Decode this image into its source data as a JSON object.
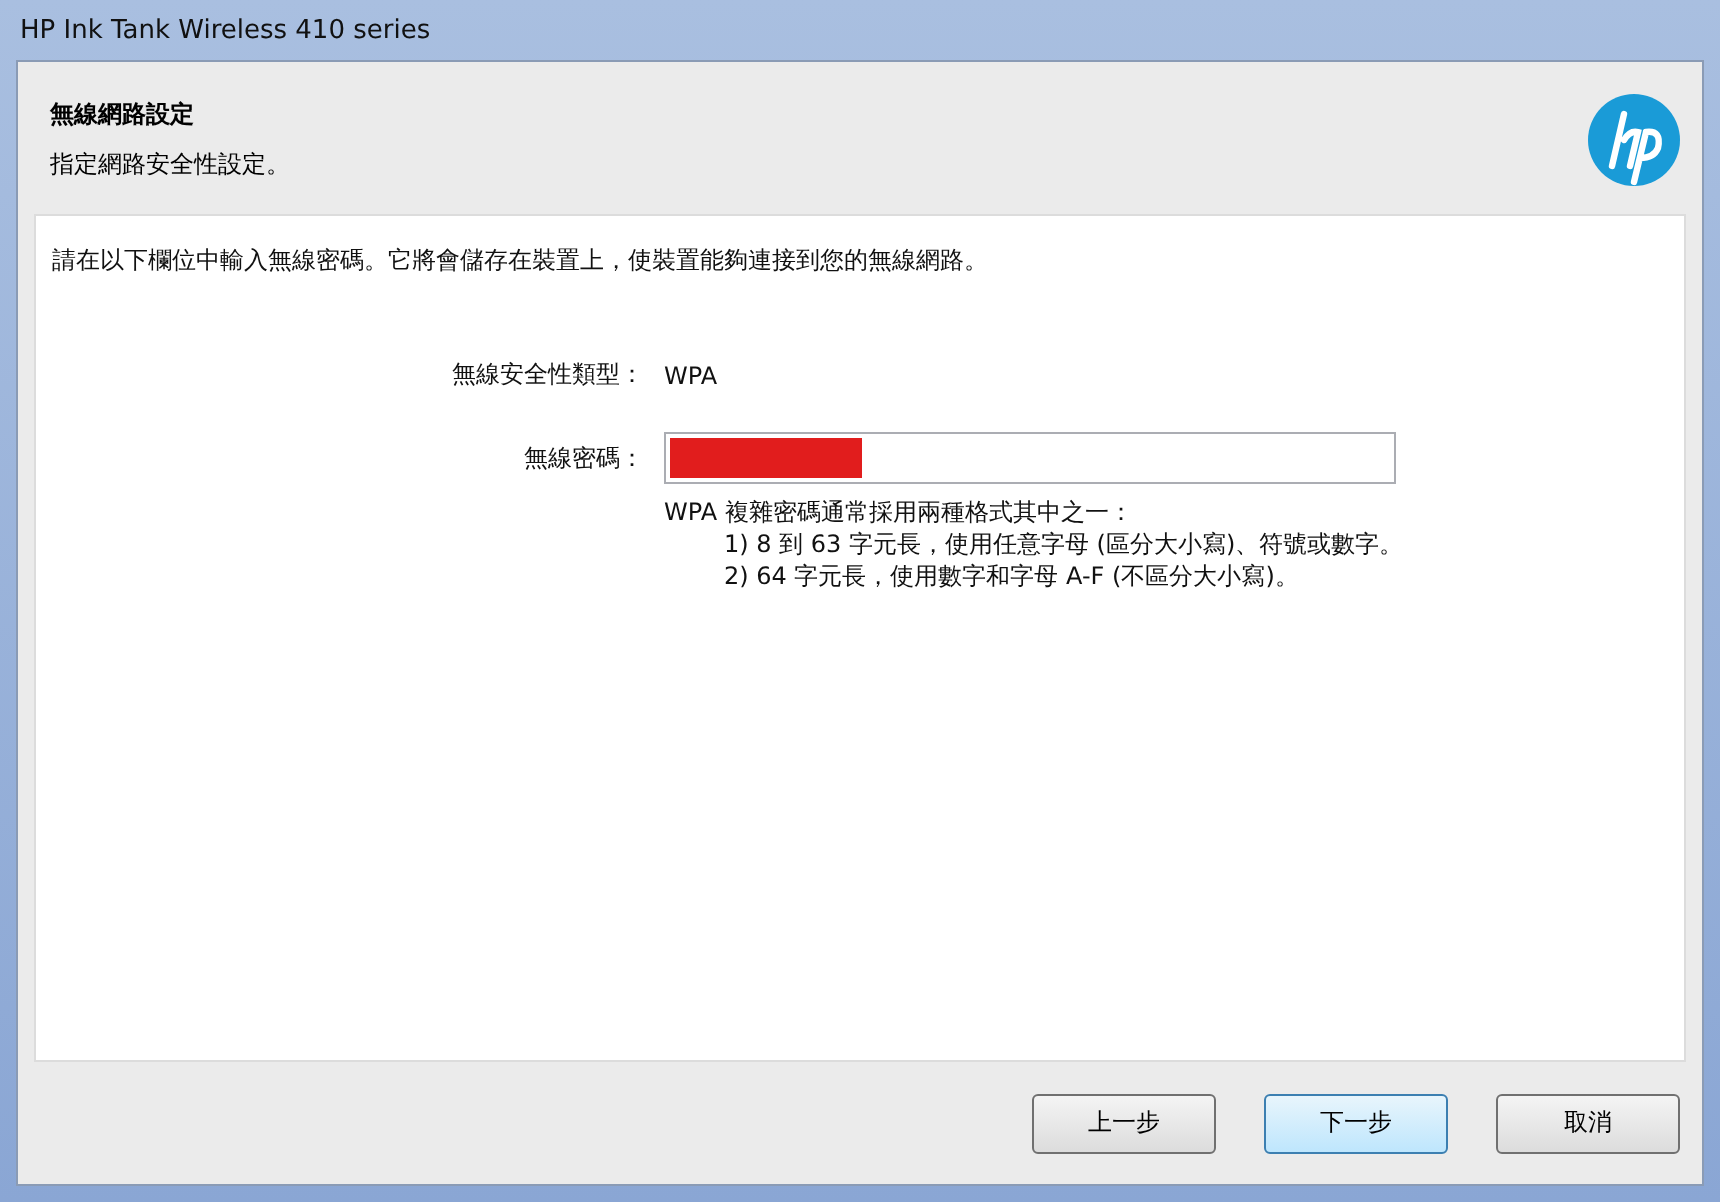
{
  "window": {
    "title": "HP Ink Tank Wireless 410 series"
  },
  "header": {
    "title": "無線網路設定",
    "subtitle": "指定網路安全性設定。"
  },
  "instruction": "請在以下欄位中輸入無線密碼。它將會儲存在裝置上，使裝置能夠連接到您的無線網路。",
  "security_type": {
    "label": "無線安全性類型：",
    "value": "WPA"
  },
  "password": {
    "label": "無線密碼：",
    "redacted": true
  },
  "hint": {
    "intro": "WPA 複雜密碼通常採用兩種格式其中之一：",
    "lines": [
      "1) 8 到 63 字元長，使用任意字母 (區分大小寫)、符號或數字。",
      "2) 64 字元長，使用數字和字母 A-F (不區分大小寫)。"
    ]
  },
  "buttons": [
    {
      "label": "上一步",
      "default": false
    },
    {
      "label": "下一步",
      "default": true
    },
    {
      "label": "取消",
      "default": false
    }
  ]
}
